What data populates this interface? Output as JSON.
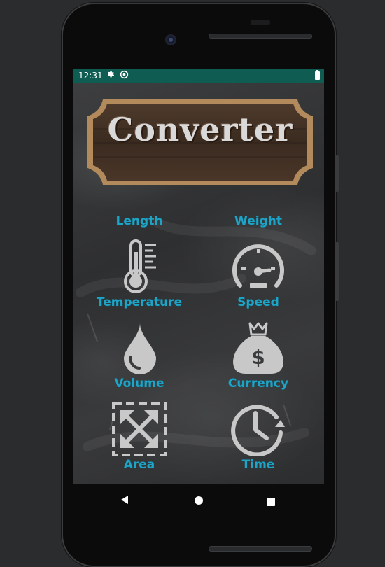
{
  "status_bar": {
    "time": "12:31",
    "settings_icon": "gear-icon",
    "sync_icon": "sync-icon",
    "battery_icon": "battery-icon",
    "color": "#0e5c52"
  },
  "header": {
    "title": "Converter"
  },
  "categories": [
    {
      "label": "Length",
      "icon": "length-icon"
    },
    {
      "label": "Weight",
      "icon": "weight-icon"
    },
    {
      "label": "Temperature",
      "icon": "thermometer-icon"
    },
    {
      "label": "Speed",
      "icon": "speedometer-icon"
    },
    {
      "label": "Volume",
      "icon": "water-drop-icon"
    },
    {
      "label": "Currency",
      "icon": "money-bag-icon"
    },
    {
      "label": "Area",
      "icon": "expand-arrows-icon"
    },
    {
      "label": "Time",
      "icon": "clock-icon"
    }
  ],
  "navigation": {
    "back_icon": "back-triangle-icon",
    "home_icon": "home-circle-icon",
    "recents_icon": "recents-square-icon"
  },
  "colors": {
    "label": "#1ea4c6",
    "icon": "#c8c8c8",
    "board": "#333436"
  }
}
